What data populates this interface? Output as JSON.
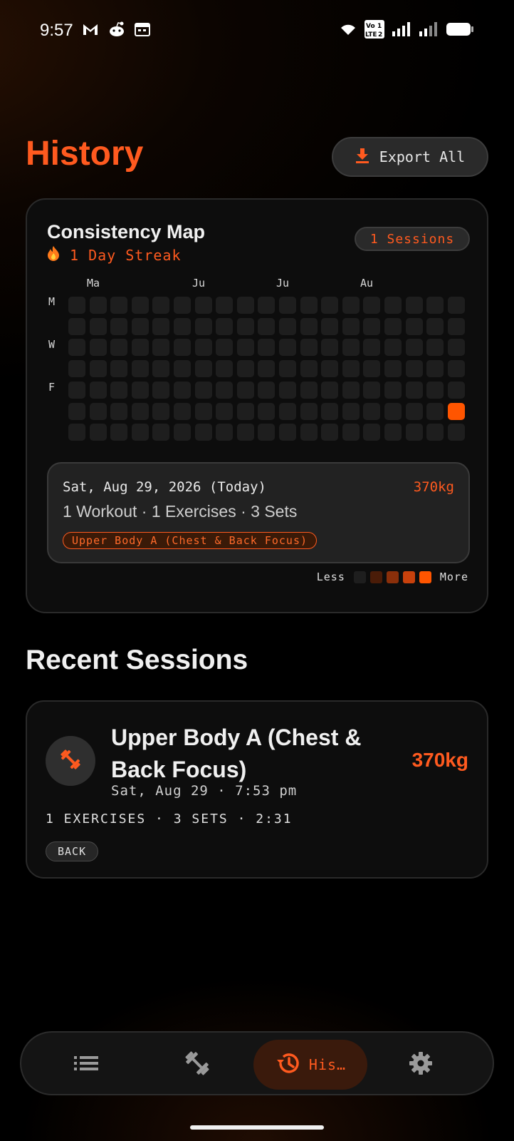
{
  "status_bar": {
    "time": "9:57",
    "icons_left": [
      "gmail-icon",
      "reddit-icon",
      "calendar-icon"
    ],
    "icons_right": [
      "wifi-icon",
      "volte-icon",
      "signal-icon",
      "signal-icon",
      "battery-icon"
    ],
    "volte_top": "Vo",
    "volte_bottom": "LTE",
    "sim1": "1",
    "sim2": "2"
  },
  "header": {
    "title": "History",
    "export_label": "Export All"
  },
  "consistency": {
    "title": "Consistency Map",
    "streak": "1 Day Streak",
    "sessions_pill": "1 Sessions",
    "months": [
      "Ma",
      "Ju",
      "Ju",
      "Au"
    ],
    "days": [
      "M",
      "W",
      "F"
    ],
    "weeks": 19,
    "active_cell": {
      "week": 18,
      "day": 5
    },
    "selected": {
      "date": "Sat, Aug 29, 2026 (Today)",
      "weight": "370kg",
      "summary": "1 Workout · 1 Exercises · 3 Sets",
      "tag": "Upper Body A (Chest & Back Focus)"
    },
    "legend_less": "Less",
    "legend_more": "More",
    "legend_colors": [
      "#1e1e1e",
      "#4a1c08",
      "#8a2f0a",
      "#c8410c",
      "#ff5500"
    ]
  },
  "recent": {
    "title": "Recent Sessions",
    "sessions": [
      {
        "name": "Upper Body A (Chest & Back Focus)",
        "weight": "370kg",
        "datetime": "Sat, Aug 29 · 7:53 pm",
        "meta": "1 EXERCISES · 3 SETS · 2:31",
        "tag": "BACK"
      }
    ]
  },
  "nav": {
    "items": [
      {
        "icon": "list-icon",
        "label": ""
      },
      {
        "icon": "dumbbell-icon",
        "label": ""
      },
      {
        "icon": "history-icon",
        "label": "His…"
      },
      {
        "icon": "gear-icon",
        "label": ""
      }
    ],
    "active_index": 2
  },
  "colors": {
    "accent": "#ff5a1f",
    "background": "#000000",
    "card": "#0d0d0d"
  }
}
